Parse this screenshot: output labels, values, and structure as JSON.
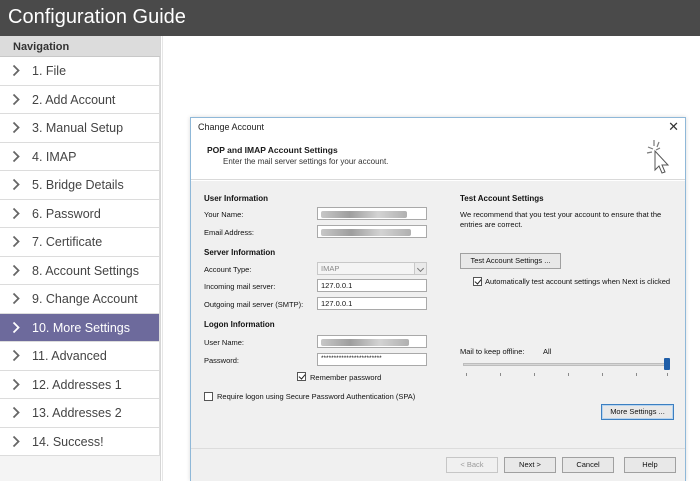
{
  "app": {
    "title": "Configuration Guide"
  },
  "navigation": {
    "header": "Navigation",
    "items": [
      {
        "label": "1. File"
      },
      {
        "label": "2. Add Account"
      },
      {
        "label": "3. Manual Setup"
      },
      {
        "label": "4. IMAP"
      },
      {
        "label": "5. Bridge Details"
      },
      {
        "label": "6. Password"
      },
      {
        "label": "7. Certificate"
      },
      {
        "label": "8. Account Settings"
      },
      {
        "label": "9. Change Account"
      },
      {
        "label": "10. More Settings",
        "active": true
      },
      {
        "label": "11. Advanced"
      },
      {
        "label": "12. Addresses 1"
      },
      {
        "label": "13. Addresses 2"
      },
      {
        "label": "14. Success!"
      }
    ],
    "active_color": "#6d6a9c"
  },
  "dialog": {
    "title": "Change Account",
    "close_icon": "close-icon",
    "heading": "POP and IMAP Account Settings",
    "subheading": "Enter the mail server settings for your account.",
    "user_info": {
      "section": "User Information",
      "name_label": "Your Name:",
      "email_label": "Email Address:"
    },
    "server_info": {
      "section": "Server Information",
      "account_type_label": "Account Type:",
      "account_type_value": "IMAP",
      "incoming_label": "Incoming mail server:",
      "incoming_value": "127.0.0.1",
      "outgoing_label": "Outgoing mail server (SMTP):",
      "outgoing_value": "127.0.0.1"
    },
    "logon_info": {
      "section": "Logon Information",
      "username_label": "User Name:",
      "password_label": "Password:",
      "password_value": "************************",
      "remember_label": "Remember password",
      "remember_checked": true,
      "spa_label": "Require logon using Secure Password Authentication (SPA)",
      "spa_checked": false
    },
    "test": {
      "section": "Test Account Settings",
      "description": "We recommend that you test your account to ensure that the entries are correct.",
      "button": "Test Account Settings ...",
      "auto_label": "Automatically test account settings when Next is clicked",
      "auto_checked": true
    },
    "offline": {
      "label": "Mail to keep offline:",
      "value": "All",
      "level": 1.0
    },
    "more_settings_button": "More Settings ...",
    "footer": {
      "back": "< Back",
      "next": "Next >",
      "cancel": "Cancel",
      "help": "Help"
    }
  }
}
